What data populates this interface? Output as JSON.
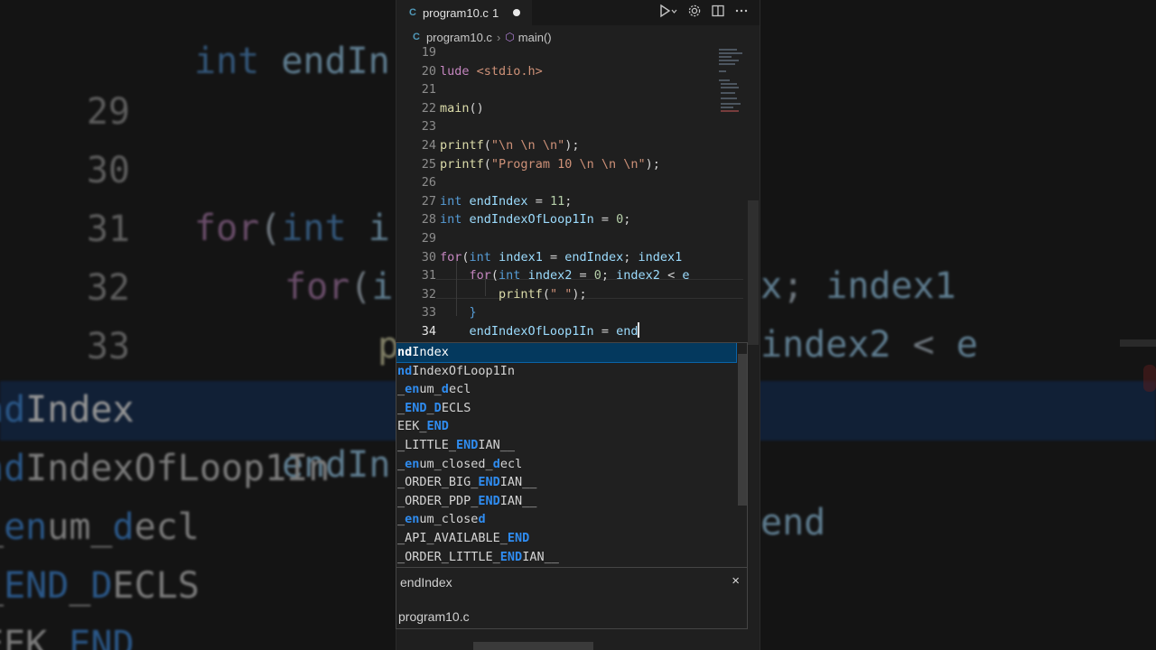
{
  "background": {
    "lines": [
      {
        "num": "29",
        "code": ""
      },
      {
        "num": "30",
        "code": "for(int index = endIndex; index1"
      },
      {
        "num": "31",
        "code": "    for(int index2 = 0; index2 < e"
      },
      {
        "num": "32",
        "code": "        printf"
      },
      {
        "num": "33",
        "code": "    }"
      },
      {
        "num": "34",
        "code": "    endIndexOfLoop1In = end"
      }
    ],
    "list": [
      "endIndex",
      "endIndexOfLoop1In",
      "_enum_decl",
      "_END_DECLS",
      "EEK_END"
    ]
  },
  "tab": {
    "icon": "C",
    "filename": "program10.c",
    "problems": "1"
  },
  "toolbar": {
    "run_icon": "run-debug-icon",
    "settings_icon": "gear-icon",
    "split_icon": "split-editor-icon",
    "more_icon": "more-icon"
  },
  "breadcrumb": {
    "icon": "C",
    "file": "program10.c",
    "symbol": "main()"
  },
  "code_lines": [
    {
      "num": "19",
      "html": ""
    },
    {
      "num": "20",
      "html": "<span class='pre'>lude</span> <span class='str'>&lt;stdio.h&gt;</span>"
    },
    {
      "num": "21",
      "html": ""
    },
    {
      "num": "22",
      "html": "<span class='fn'>main</span>()"
    },
    {
      "num": "23",
      "html": ""
    },
    {
      "num": "24",
      "html": "<span class='fn'>printf</span>(<span class='str'>\"\\n \\n \\n\"</span>);"
    },
    {
      "num": "25",
      "html": "<span class='fn'>printf</span>(<span class='str'>\"Program 10 \\n \\n \\n\"</span>);"
    },
    {
      "num": "26",
      "html": ""
    },
    {
      "num": "27",
      "html": "<span class='kw'>int</span> <span class='var'>endIndex</span> = <span class='num'>11</span>;"
    },
    {
      "num": "28",
      "html": "<span class='kw'>int</span> <span class='var'>endIndexOfLoop1In</span> = <span class='num'>0</span>;"
    },
    {
      "num": "29",
      "html": ""
    },
    {
      "num": "30",
      "html": "<span class='ctl'>for</span>(<span class='kw'>int</span> <span class='var'>index1</span> = <span class='var'>endIndex</span>; <span class='var'>index1</span>"
    },
    {
      "num": "31",
      "html": "    <span class='ctl'>for</span>(<span class='kw'>int</span> <span class='var'>index2</span> = <span class='num'>0</span>; <span class='var'>index2</span> &lt; <span class='var'>e</span>"
    },
    {
      "num": "32",
      "html": "        <span class='fn'>printf</span>(<span class='str'>\" \"</span>);"
    },
    {
      "num": "33",
      "html": "    <span class='kw'>}</span>"
    },
    {
      "num": "34",
      "html": "    <span class='var'>endIndexOfLoop1In</span> = <span class='var'>end</span><span class='caret'></span>"
    }
  ],
  "active_line": "34",
  "suggestions": [
    {
      "pre": "",
      "match": "end",
      "post": "Index",
      "display": "ndIndex",
      "selected": true
    },
    {
      "display_html": "<span class='m'>nd</span>IndexOfLoop1In"
    },
    {
      "display_html": "_<span class='m'>en</span>um_<span class='m'>d</span>ecl"
    },
    {
      "display_html": "_<span class='m'>END</span>_<span class='m'>D</span>ECLS"
    },
    {
      "display_html": "EEK_<span class='m'>END</span>"
    },
    {
      "display_html": "_LITTLE_<span class='m'>END</span>IAN__"
    },
    {
      "display_html": "_<span class='m'>en</span>um_closed_<span class='m'>d</span>ecl"
    },
    {
      "display_html": "_ORDER_BIG_<span class='m'>END</span>IAN__"
    },
    {
      "display_html": "_ORDER_PDP_<span class='m'>END</span>IAN__"
    },
    {
      "display_html": "_<span class='m'>en</span>um_close<span class='m'>d</span>"
    },
    {
      "display_html": "_API_AVAILABLE_<span class='m'>END</span>"
    },
    {
      "display_html": "_ORDER_LITTLE_<span class='m'>END</span>IAN__"
    }
  ],
  "details": {
    "title": "endIndex",
    "close": "×",
    "file": "program10.c"
  }
}
